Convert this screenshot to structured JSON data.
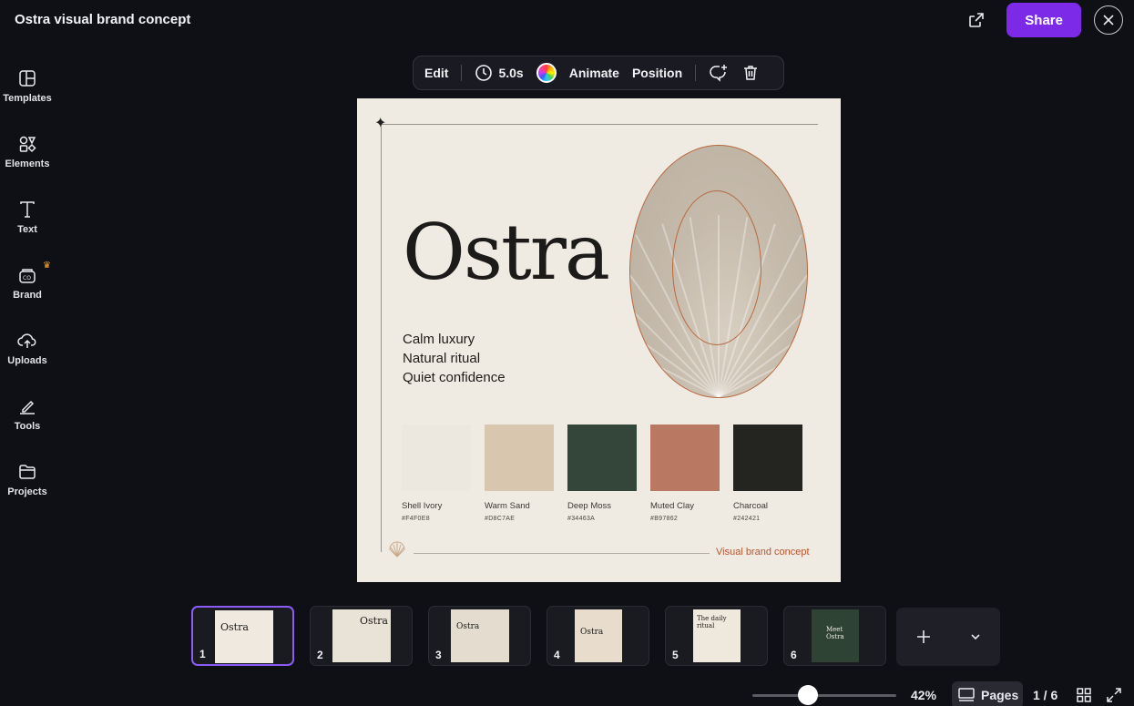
{
  "header": {
    "title": "Ostra visual brand concept",
    "share_label": "Share",
    "external_icon": "external-link-icon",
    "close_icon": "close-icon"
  },
  "sidebar": {
    "items": [
      {
        "label": "Templates",
        "icon": "templates-icon"
      },
      {
        "label": "Elements",
        "icon": "elements-icon"
      },
      {
        "label": "Text",
        "icon": "text-icon"
      },
      {
        "label": "Brand",
        "icon": "brand-icon",
        "crown": true
      },
      {
        "label": "Uploads",
        "icon": "uploads-icon"
      },
      {
        "label": "Tools",
        "icon": "tools-icon"
      },
      {
        "label": "Projects",
        "icon": "projects-icon"
      }
    ]
  },
  "toolbar": {
    "edit_label": "Edit",
    "duration": "5.0s",
    "animate_label": "Animate",
    "position_label": "Position"
  },
  "design": {
    "brand_name": "Ostra",
    "taglines": [
      "Calm luxury",
      "Natural ritual",
      "Quiet confidence"
    ],
    "swatches": [
      {
        "name": "Shell Ivory",
        "hex": "#F4F0E8",
        "color": "#ece8e0"
      },
      {
        "name": "Warm Sand",
        "hex": "#D8C7AE",
        "color": "#d8c7ae"
      },
      {
        "name": "Deep Moss",
        "hex": "#34463A",
        "color": "#34463a"
      },
      {
        "name": "Muted Clay",
        "hex": "#B97862",
        "color": "#b97862"
      },
      {
        "name": "Charcoal",
        "hex": "#242421",
        "color": "#242421"
      }
    ],
    "caption": "Visual brand concept",
    "accent_color": "#b8683f"
  },
  "thumbnails": {
    "pages": [
      {
        "num": "1",
        "title": "Ostra"
      },
      {
        "num": "2",
        "title": "Ostra"
      },
      {
        "num": "3",
        "title": "Ostra"
      },
      {
        "num": "4",
        "title": "Ostra"
      },
      {
        "num": "5",
        "title": "The daily ritual"
      },
      {
        "num": "6",
        "title": "Meet Ostra"
      }
    ]
  },
  "footer": {
    "zoom": "42%",
    "zoom_level": 0.42,
    "pages_label": "Pages",
    "page_count": "1 / 6"
  }
}
